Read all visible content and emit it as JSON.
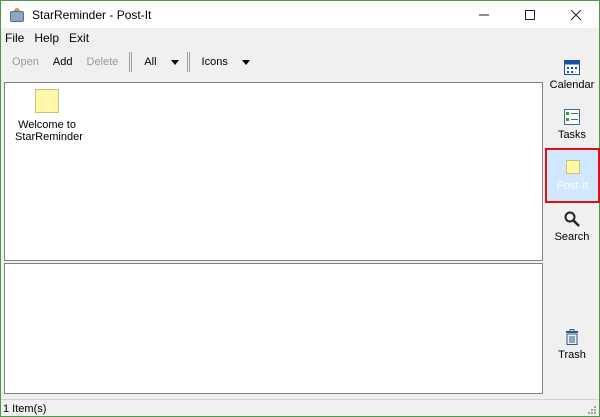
{
  "window": {
    "title": "StarReminder - Post-It"
  },
  "menu": [
    "File",
    "Help",
    "Exit"
  ],
  "toolbar": {
    "open_label": "Open",
    "add_label": "Add",
    "delete_label": "Delete",
    "filter_value": "All",
    "view_value": "Icons"
  },
  "notes": [
    {
      "label": "Welcome to StarReminder"
    }
  ],
  "sidebar": {
    "items": [
      {
        "label": "Calendar",
        "icon": "calendar-icon"
      },
      {
        "label": "Tasks",
        "icon": "tasks-icon"
      },
      {
        "label": "Post-It",
        "icon": "postit-icon",
        "active": true
      },
      {
        "label": "Search",
        "icon": "search-icon"
      },
      {
        "label": "Trash",
        "icon": "trash-icon"
      }
    ]
  },
  "status": {
    "text": "1 Item(s)"
  },
  "colors": {
    "active_highlight": "#cfe7ff",
    "annotation_border": "#e01010",
    "note_yellow": "#fff8a8"
  }
}
